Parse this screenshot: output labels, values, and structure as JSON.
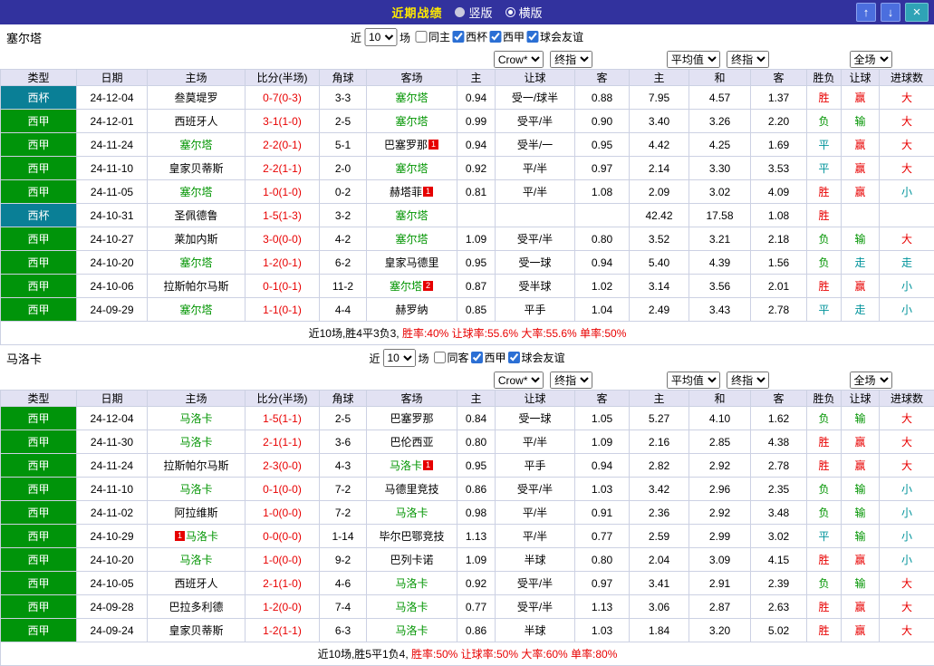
{
  "topbar": {
    "title": "近期战绩",
    "radio_vertical": "竖版",
    "radio_horizontal": "横版",
    "up_icon": "↑",
    "down_icon": "↓",
    "close_icon": "×"
  },
  "labels": {
    "near": "近",
    "matches": "场",
    "count": "10"
  },
  "selects": {
    "bookmaker": "Crow*",
    "final": "终指",
    "average": "平均值",
    "full": "全场"
  },
  "columns": [
    "类型",
    "日期",
    "主场",
    "比分(半场)",
    "角球",
    "客场",
    "主",
    "让球",
    "客",
    "主",
    "和",
    "客",
    "胜负",
    "让球",
    "进球数"
  ],
  "sections": [
    {
      "team": "塞尔塔",
      "filter_checkboxes": [
        {
          "label": "同主",
          "checked": false
        },
        {
          "label": "西杯",
          "checked": true
        },
        {
          "label": "西甲",
          "checked": true
        },
        {
          "label": "球会友谊",
          "checked": true
        }
      ],
      "rows": [
        {
          "league": "西杯",
          "date": "24-12-04",
          "home": "叁莫堤罗",
          "score": "0-7(0-3)",
          "corner": "3-3",
          "away": "塞尔塔",
          "away_focus": true,
          "odds_home": "0.94",
          "handicap": "受一/球半",
          "odds_away": "0.88",
          "avg_home": "7.95",
          "avg_draw": "4.57",
          "avg_away": "1.37",
          "result": "胜",
          "handicap_result": "赢",
          "goals": "大"
        },
        {
          "league": "西甲",
          "date": "24-12-01",
          "home": "西班牙人",
          "score": "3-1(1-0)",
          "corner": "2-5",
          "away": "塞尔塔",
          "away_focus": true,
          "odds_home": "0.99",
          "handicap": "受平/半",
          "odds_away": "0.90",
          "avg_home": "3.40",
          "avg_draw": "3.26",
          "avg_away": "2.20",
          "result": "负",
          "handicap_result": "输",
          "goals": "大"
        },
        {
          "league": "西甲",
          "date": "24-11-24",
          "home": "塞尔塔",
          "home_focus": true,
          "score": "2-2(0-1)",
          "corner": "5-1",
          "away": "巴塞罗那",
          "away_badge": "1",
          "odds_home": "0.94",
          "handicap": "受半/一",
          "odds_away": "0.95",
          "avg_home": "4.42",
          "avg_draw": "4.25",
          "avg_away": "1.69",
          "result": "平",
          "handicap_result": "赢",
          "goals": "大"
        },
        {
          "league": "西甲",
          "date": "24-11-10",
          "home": "皇家贝蒂斯",
          "score": "2-2(1-1)",
          "corner": "2-0",
          "away": "塞尔塔",
          "away_focus": true,
          "odds_home": "0.92",
          "handicap": "平/半",
          "odds_away": "0.97",
          "avg_home": "2.14",
          "avg_draw": "3.30",
          "avg_away": "3.53",
          "result": "平",
          "handicap_result": "赢",
          "goals": "大"
        },
        {
          "league": "西甲",
          "date": "24-11-05",
          "home": "塞尔塔",
          "home_focus": true,
          "score": "1-0(1-0)",
          "corner": "0-2",
          "away": "赫塔菲",
          "away_badge": "1",
          "odds_home": "0.81",
          "handicap": "平/半",
          "odds_away": "1.08",
          "avg_home": "2.09",
          "avg_draw": "3.02",
          "avg_away": "4.09",
          "result": "胜",
          "handicap_result": "赢",
          "goals": "小"
        },
        {
          "league": "西杯",
          "date": "24-10-31",
          "home": "圣佩德鲁",
          "score": "1-5(1-3)",
          "corner": "3-2",
          "away": "塞尔塔",
          "away_focus": true,
          "odds_home": "",
          "handicap": "",
          "odds_away": "",
          "avg_home": "42.42",
          "avg_draw": "17.58",
          "avg_away": "1.08",
          "result": "胜",
          "handicap_result": "",
          "goals": ""
        },
        {
          "league": "西甲",
          "date": "24-10-27",
          "home": "莱加内斯",
          "score": "3-0(0-0)",
          "corner": "4-2",
          "away": "塞尔塔",
          "away_focus": true,
          "odds_home": "1.09",
          "handicap": "受平/半",
          "odds_away": "0.80",
          "avg_home": "3.52",
          "avg_draw": "3.21",
          "avg_away": "2.18",
          "result": "负",
          "handicap_result": "输",
          "goals": "大"
        },
        {
          "league": "西甲",
          "date": "24-10-20",
          "home": "塞尔塔",
          "home_focus": true,
          "score": "1-2(0-1)",
          "corner": "6-2",
          "away": "皇家马德里",
          "odds_home": "0.95",
          "handicap": "受一球",
          "odds_away": "0.94",
          "avg_home": "5.40",
          "avg_draw": "4.39",
          "avg_away": "1.56",
          "result": "负",
          "handicap_result": "走",
          "goals": "走"
        },
        {
          "league": "西甲",
          "date": "24-10-06",
          "home": "拉斯帕尔马斯",
          "score": "0-1(0-1)",
          "corner": "11-2",
          "away": "塞尔塔",
          "away_focus": true,
          "away_badge": "2",
          "odds_home": "0.87",
          "handicap": "受半球",
          "odds_away": "1.02",
          "avg_home": "3.14",
          "avg_draw": "3.56",
          "avg_away": "2.01",
          "result": "胜",
          "handicap_result": "赢",
          "goals": "小"
        },
        {
          "league": "西甲",
          "date": "24-09-29",
          "home": "塞尔塔",
          "home_focus": true,
          "score": "1-1(0-1)",
          "corner": "4-4",
          "away": "赫罗纳",
          "odds_home": "0.85",
          "handicap": "平手",
          "odds_away": "1.04",
          "avg_home": "2.49",
          "avg_draw": "3.43",
          "avg_away": "2.78",
          "result": "平",
          "handicap_result": "走",
          "goals": "小"
        }
      ],
      "summary_prefix": "近10场,胜4平3负3, ",
      "summary_rates": "胜率:40% 让球率:55.6% 大率:55.6% 单率:50%"
    },
    {
      "team": "马洛卡",
      "filter_checkboxes": [
        {
          "label": "同客",
          "checked": false
        },
        {
          "label": "西甲",
          "checked": true
        },
        {
          "label": "球会友谊",
          "checked": true
        }
      ],
      "rows": [
        {
          "league": "西甲",
          "date": "24-12-04",
          "home": "马洛卡",
          "home_focus": true,
          "score": "1-5(1-1)",
          "corner": "2-5",
          "away": "巴塞罗那",
          "odds_home": "0.84",
          "handicap": "受一球",
          "odds_away": "1.05",
          "avg_home": "5.27",
          "avg_draw": "4.10",
          "avg_away": "1.62",
          "result": "负",
          "handicap_result": "输",
          "goals": "大"
        },
        {
          "league": "西甲",
          "date": "24-11-30",
          "home": "马洛卡",
          "home_focus": true,
          "score": "2-1(1-1)",
          "corner": "3-6",
          "away": "巴伦西亚",
          "odds_home": "0.80",
          "handicap": "平/半",
          "odds_away": "1.09",
          "avg_home": "2.16",
          "avg_draw": "2.85",
          "avg_away": "4.38",
          "result": "胜",
          "handicap_result": "赢",
          "goals": "大"
        },
        {
          "league": "西甲",
          "date": "24-11-24",
          "home": "拉斯帕尔马斯",
          "score": "2-3(0-0)",
          "corner": "4-3",
          "away": "马洛卡",
          "away_focus": true,
          "away_badge": "1",
          "odds_home": "0.95",
          "handicap": "平手",
          "odds_away": "0.94",
          "avg_home": "2.82",
          "avg_draw": "2.92",
          "avg_away": "2.78",
          "result": "胜",
          "handicap_result": "赢",
          "goals": "大"
        },
        {
          "league": "西甲",
          "date": "24-11-10",
          "home": "马洛卡",
          "home_focus": true,
          "score": "0-1(0-0)",
          "corner": "7-2",
          "away": "马德里竞技",
          "odds_home": "0.86",
          "handicap": "受平/半",
          "odds_away": "1.03",
          "avg_home": "3.42",
          "avg_draw": "2.96",
          "avg_away": "2.35",
          "result": "负",
          "handicap_result": "输",
          "goals": "小"
        },
        {
          "league": "西甲",
          "date": "24-11-02",
          "home": "阿拉维斯",
          "score": "1-0(0-0)",
          "corner": "7-2",
          "away": "马洛卡",
          "away_focus": true,
          "odds_home": "0.98",
          "handicap": "平/半",
          "odds_away": "0.91",
          "avg_home": "2.36",
          "avg_draw": "2.92",
          "avg_away": "3.48",
          "result": "负",
          "handicap_result": "输",
          "goals": "小"
        },
        {
          "league": "西甲",
          "date": "24-10-29",
          "home": "马洛卡",
          "home_focus": true,
          "home_badge": "1",
          "home_badge_before": true,
          "score": "0-0(0-0)",
          "corner": "1-14",
          "away": "毕尔巴鄂竞技",
          "odds_home": "1.13",
          "handicap": "平/半",
          "odds_away": "0.77",
          "avg_home": "2.59",
          "avg_draw": "2.99",
          "avg_away": "3.02",
          "result": "平",
          "handicap_result": "输",
          "goals": "小"
        },
        {
          "league": "西甲",
          "date": "24-10-20",
          "home": "马洛卡",
          "home_focus": true,
          "score": "1-0(0-0)",
          "corner": "9-2",
          "away": "巴列卡诺",
          "odds_home": "1.09",
          "handicap": "半球",
          "odds_away": "0.80",
          "avg_home": "2.04",
          "avg_draw": "3.09",
          "avg_away": "4.15",
          "result": "胜",
          "handicap_result": "赢",
          "goals": "小"
        },
        {
          "league": "西甲",
          "date": "24-10-05",
          "home": "西班牙人",
          "score": "2-1(1-0)",
          "corner": "4-6",
          "away": "马洛卡",
          "away_focus": true,
          "odds_home": "0.92",
          "handicap": "受平/半",
          "odds_away": "0.97",
          "avg_home": "3.41",
          "avg_draw": "2.91",
          "avg_away": "2.39",
          "result": "负",
          "handicap_result": "输",
          "goals": "大"
        },
        {
          "league": "西甲",
          "date": "24-09-28",
          "home": "巴拉多利德",
          "score": "1-2(0-0)",
          "corner": "7-4",
          "away": "马洛卡",
          "away_focus": true,
          "odds_home": "0.77",
          "handicap": "受平/半",
          "odds_away": "1.13",
          "avg_home": "3.06",
          "avg_draw": "2.87",
          "avg_away": "2.63",
          "result": "胜",
          "handicap_result": "赢",
          "goals": "大"
        },
        {
          "league": "西甲",
          "date": "24-09-24",
          "home": "皇家贝蒂斯",
          "score": "1-2(1-1)",
          "corner": "6-3",
          "away": "马洛卡",
          "away_focus": true,
          "odds_home": "0.86",
          "handicap": "半球",
          "odds_away": "1.03",
          "avg_home": "1.84",
          "avg_draw": "3.20",
          "avg_away": "5.02",
          "result": "胜",
          "handicap_result": "赢",
          "goals": "大"
        }
      ],
      "summary_prefix": "近10场,胜5平1负4, ",
      "summary_rates": "胜率:50% 让球率:50% 大率:60% 单率:80%"
    }
  ]
}
